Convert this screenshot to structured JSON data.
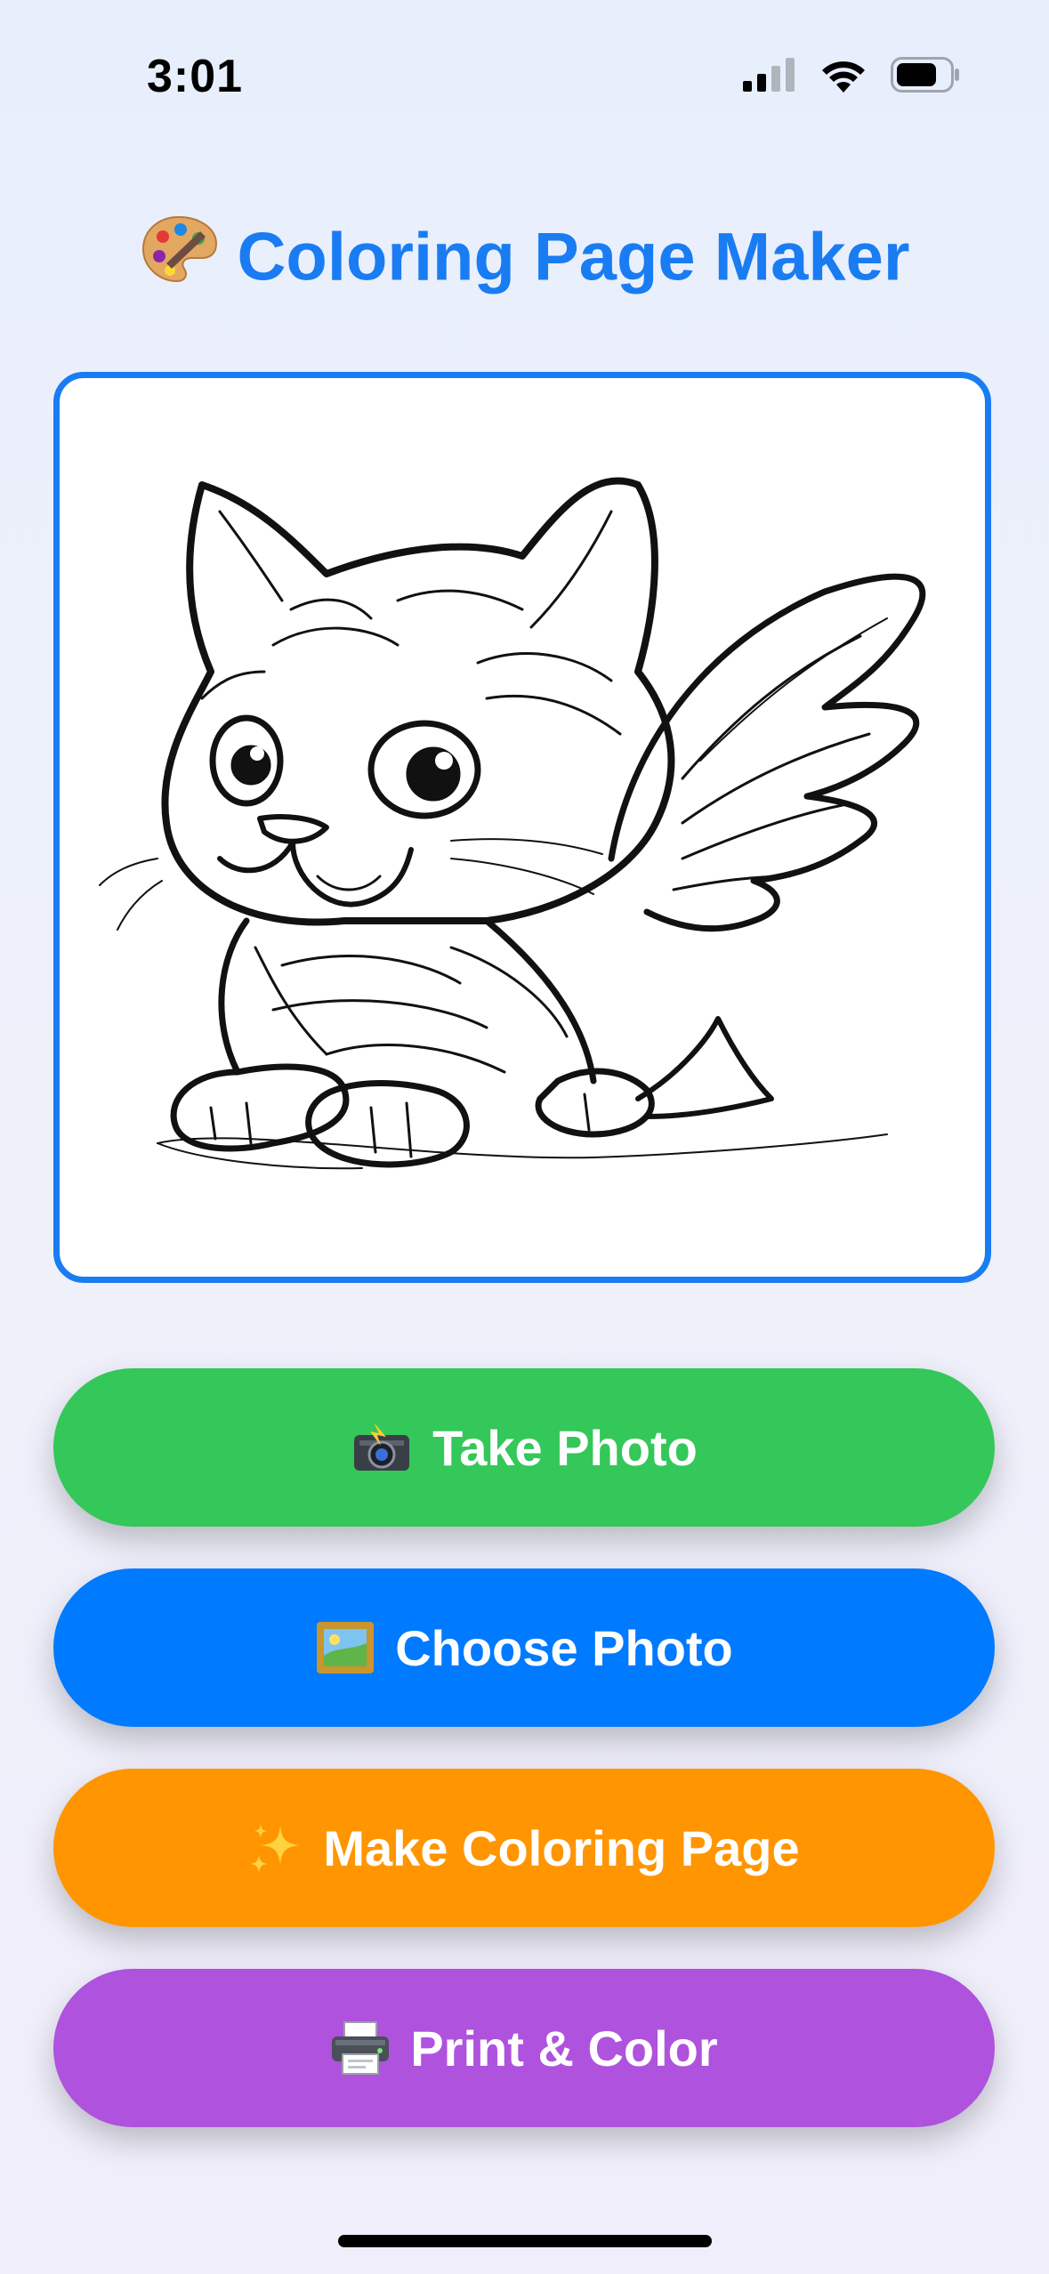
{
  "status_bar": {
    "time": "3:01"
  },
  "header": {
    "title": "Coloring Page Maker",
    "title_icon": "artist-palette-icon"
  },
  "preview": {
    "image": "coloring page line art: winged kitten",
    "border_color": "#1a7cf2"
  },
  "buttons": [
    {
      "label": "Take Photo",
      "icon": "camera-flash-icon",
      "color": "#34c759"
    },
    {
      "label": "Choose Photo",
      "icon": "framed-picture-icon",
      "color": "#007aff"
    },
    {
      "label": "Make Coloring Page",
      "icon": "sparkles-icon",
      "color": "#ff9500"
    },
    {
      "label": "Print & Color",
      "icon": "printer-icon",
      "color": "#af52de"
    }
  ]
}
